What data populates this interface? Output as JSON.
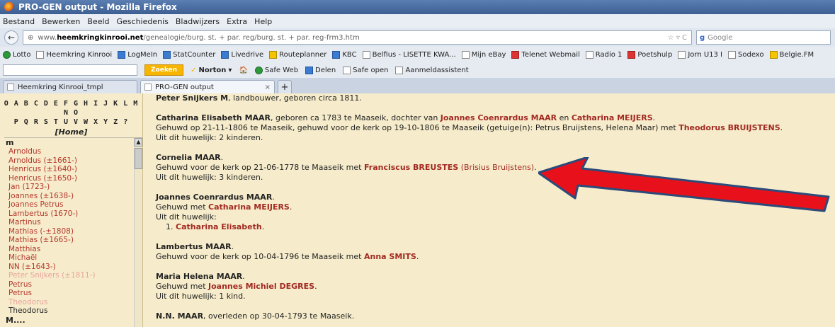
{
  "window": {
    "title": "PRO-GEN output - Mozilla Firefox"
  },
  "menu": [
    "Bestand",
    "Bewerken",
    "Beeld",
    "Geschiedenis",
    "Bladwijzers",
    "Extra",
    "Help"
  ],
  "nav": {
    "url_prefix": "www.",
    "url_host": "heemkringkinrooi.net",
    "url_path": "/genealogie/burg. st. + par. reg/burg. st. + par. reg-frm3.htm",
    "url_right": "☆ ▿ C",
    "search_placeholder": "Google"
  },
  "bookmarks": [
    "Lotto",
    "Heemkring Kinrooi",
    "LogMeIn",
    "StatCounter",
    "Livedrive",
    "Routeplanner",
    "KBC",
    "Belfius - LISETTE KWA...",
    "Mijn eBay",
    "Telenet Webmail",
    "Radio 1",
    "Poetshulp",
    "Jorn U13 I",
    "Sodexo",
    "Belgie.FM"
  ],
  "toolbar2": {
    "zoeken": "Zoeken",
    "norton": "Norton",
    "safeweb": "Safe Web",
    "delen": "Delen",
    "safeopen": "Safe open",
    "aanmeld": "Aanmeldassistent"
  },
  "tabs": [
    {
      "label": "Heemkring Kinrooi_tmpl"
    },
    {
      "label": "PRO-GEN output"
    }
  ],
  "sidebar": {
    "alpha_line1": "O A B C D E F G H I J K L M N O",
    "alpha_line2": "P Q R S T U V W X Y Z ?",
    "home": "[Home]",
    "header": "m",
    "items": [
      {
        "label": "Arnoldus",
        "style": ""
      },
      {
        "label": "Arnoldus (±1661-)",
        "style": ""
      },
      {
        "label": "Henricus (±1640-)",
        "style": ""
      },
      {
        "label": "Henricus (±1650-)",
        "style": ""
      },
      {
        "label": "Jan (1723-)",
        "style": ""
      },
      {
        "label": "Joannes (±1638-)",
        "style": ""
      },
      {
        "label": "Joannes Petrus",
        "style": ""
      },
      {
        "label": "Lambertus (1670-)",
        "style": ""
      },
      {
        "label": "Martinus",
        "style": ""
      },
      {
        "label": "Mathias (-±1808)",
        "style": ""
      },
      {
        "label": "Mathias (±1665-)",
        "style": ""
      },
      {
        "label": "Matthias",
        "style": ""
      },
      {
        "label": "Michaël",
        "style": ""
      },
      {
        "label": "NN (±1643-)",
        "style": ""
      },
      {
        "label": "Peter Snijkers (±1811-)",
        "style": "faded"
      },
      {
        "label": "Petrus",
        "style": ""
      },
      {
        "label": "Petrus",
        "style": ""
      },
      {
        "label": "Theodorus",
        "style": "faded"
      },
      {
        "label": "Theodorus",
        "style": "dark"
      }
    ],
    "footer": "M...."
  },
  "main": {
    "e0": {
      "name": "Peter Snijkers M",
      "rest": ", landbouwer, geboren circa 1811."
    },
    "e1": {
      "name": "Catharina Elisabeth MAAR",
      "t1": ", geboren ca 1783 te Maaseik, dochter van ",
      "father": "Joannes Coenrardus MAAR",
      "t2": " en ",
      "mother": "Catharina MEIJERS",
      "t3": ".",
      "l2a": "Gehuwd op 21-11-1806 te Maaseik, gehuwd voor de kerk op 19-10-1806 te Maaseik (getuige(n): Petrus Bruijstens, Helena Maar) met ",
      "spouse": "Theodorus BRUIJSTENS",
      "l2b": ".",
      "l3": "Uit dit huwelijk: 2 kinderen."
    },
    "e2": {
      "name": "Cornelia MAAR",
      "t1": ".",
      "l2a": "Gehuwd voor de kerk op 21-06-1778 te Maaseik met ",
      "spouse": "Franciscus BREUSTES",
      "alt": " (Brisius Bruijstens)",
      "l2b": ".",
      "l3": "Uit dit huwelijk: 3 kinderen."
    },
    "e3": {
      "name": "Joannes Coenrardus MAAR",
      "t1": ".",
      "l2a": "Gehuwd met ",
      "spouse": "Catharina MEIJERS",
      "l2b": ".",
      "l3": "Uit dit huwelijk:",
      "child_num": "1. ",
      "child": "Catharina Elisabeth",
      "child_end": "."
    },
    "e4": {
      "name": "Lambertus MAAR",
      "t1": ".",
      "l2a": "Gehuwd voor de kerk op 10-04-1796 te Maaseik met ",
      "spouse": "Anna SMITS",
      "l2b": "."
    },
    "e5": {
      "name": "Maria Helena MAAR",
      "t1": ".",
      "l2a": "Gehuwd met ",
      "spouse": "Joannes Michiel DEGRES",
      "l2b": ".",
      "l3": "Uit dit huwelijk: 1 kind."
    },
    "e6": {
      "name": "N.N. MAAR",
      "rest": ", overleden op 30-04-1793 te Maaseik."
    }
  },
  "colors": {
    "link": "#a22a22",
    "bg": "#f6eccb",
    "arrow": "#e8111b",
    "arrow_outline": "#2c4a7a"
  }
}
